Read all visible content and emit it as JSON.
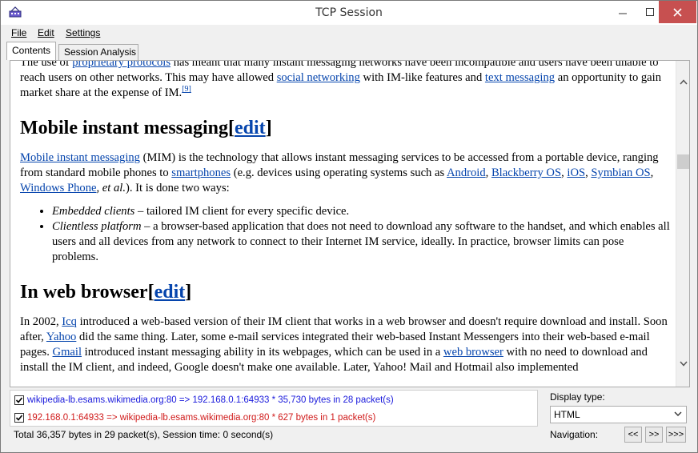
{
  "window": {
    "title": "TCP Session"
  },
  "menu": {
    "file": "File",
    "edit": "Edit",
    "settings": "Settings"
  },
  "tabs": {
    "contents": "Contents",
    "session_analysis": "Session Analysis"
  },
  "doc": {
    "p0": {
      "t1": "The use of ",
      "l1": "proprietary protocols",
      "t2": " has meant that many instant messaging networks have been incompatible and users have been unable to reach users on other networks. This may have allowed ",
      "l2": "social networking",
      "t3": " with IM-like features and ",
      "l3": "text messaging",
      "t4": " an opportunity to gain market share at the expense of IM.",
      "ref": "[9]"
    },
    "h_mobile": {
      "text": "Mobile instant messaging",
      "br_open": "[",
      "edit": "edit",
      "br_close": "]"
    },
    "p1": {
      "l1": "Mobile instant messaging",
      "t1": " (MIM) is the technology that allows instant messaging services to be accessed from a portable device, ranging from standard mobile phones to ",
      "l2": "smartphones",
      "t2": " (e.g. devices using operating systems such as ",
      "l3": "Android",
      "t3": ", ",
      "l4": "Blackberry OS",
      "t4": ", ",
      "l5": "iOS",
      "t5": ", ",
      "l6": "Symbian OS",
      "t6": ", ",
      "l7": "Windows Phone",
      "t7": ", ",
      "em": "et al.",
      "t8": "). It is done two ways:"
    },
    "list": [
      {
        "em": "Embedded clients",
        "text": " – tailored IM client for every specific device."
      },
      {
        "em": "Clientless platform",
        "text": " – a browser-based application that does not need to download any software to the handset, and which enables all users and all devices from any network to connect to their Internet IM service, ideally. In practice, browser limits can pose problems."
      }
    ],
    "h_web": {
      "text": "In web browser",
      "br_open": "[",
      "edit": "edit",
      "br_close": "]"
    },
    "p2": {
      "t1": "In 2002, ",
      "l1": "Icq",
      "t2": " introduced a web-based version of their IM client that works in a web browser and doesn't require download and install. Soon after, ",
      "l2": "Yahoo",
      "t3": " did the same thing. Later, some e-mail services integrated their web-based Instant Messengers into their web-based e-mail pages. ",
      "l3": "Gmail",
      "t4": " introduced instant messaging ability in its webpages, which can be used in a ",
      "l4": "web browser",
      "t5": " with no need to download and install the IM client, and indeed, Google doesn't make one available. Later, Yahoo! Mail and Hotmail also implemented"
    }
  },
  "sessions": [
    {
      "label": "wikipedia-lb.esams.wikimedia.org:80 => 192.168.0.1:64933 * 35,730 bytes in 28 packet(s)",
      "checked": true,
      "color": "#1a1adc"
    },
    {
      "label": "192.168.0.1:64933 => wikipedia-lb.esams.wikimedia.org:80 * 627 bytes in 1 packet(s)",
      "checked": true,
      "color": "#d01a1a"
    }
  ],
  "summary": "Total 36,357 bytes in 29 packet(s), Session time: 0 second(s)",
  "display": {
    "label": "Display type:",
    "value": "HTML"
  },
  "navigation": {
    "label": "Navigation:",
    "first": "<<",
    "next": ">>",
    "last": ">>>"
  }
}
